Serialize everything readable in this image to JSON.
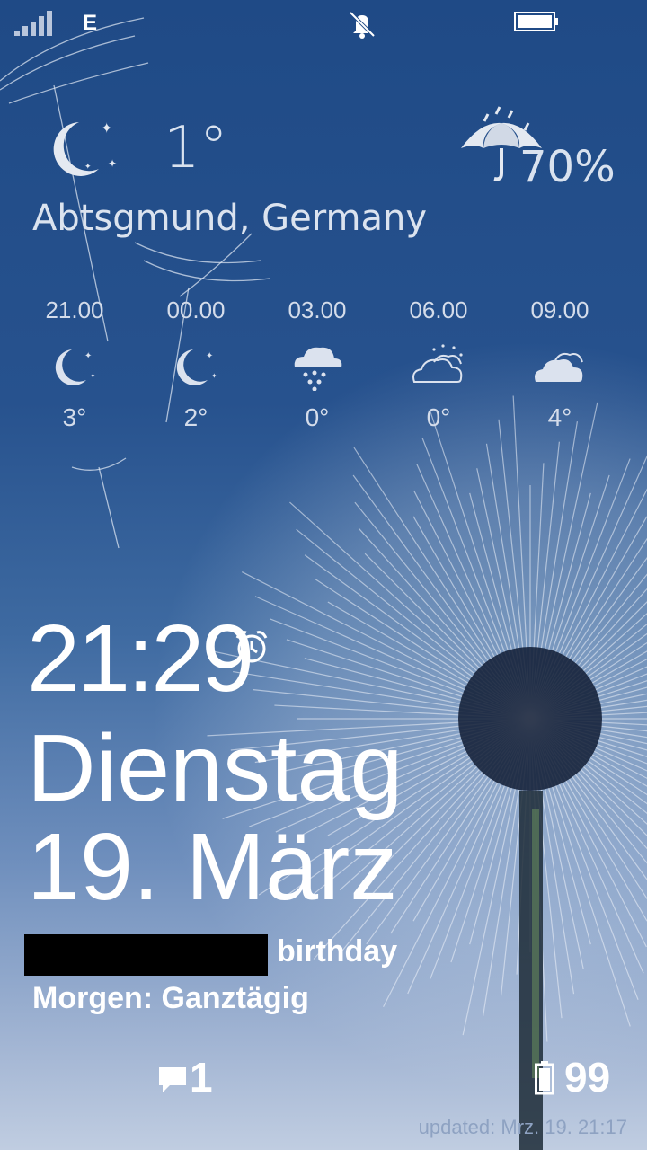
{
  "status_bar": {
    "network": "E",
    "signal_icon": "signal-bars-icon",
    "mute_icon": "bell-muted-icon",
    "battery_icon": "battery-icon"
  },
  "weather": {
    "current_temp": "1°",
    "current_icon": "moon-stars-icon",
    "precip_icon": "umbrella-rain-icon",
    "precip": "70%",
    "location": "Abtsgmund, Germany",
    "forecast": [
      {
        "time": "21.00",
        "icon": "moon-stars-icon",
        "temp": "3°"
      },
      {
        "time": "00.00",
        "icon": "moon-stars-icon",
        "temp": "2°"
      },
      {
        "time": "03.00",
        "icon": "snow-cloud-icon",
        "temp": "0°"
      },
      {
        "time": "06.00",
        "icon": "cloud-sun-icon",
        "temp": "0°"
      },
      {
        "time": "09.00",
        "icon": "cloud-icon",
        "temp": "4°"
      }
    ]
  },
  "lock": {
    "time": "21:29",
    "alarm_icon": "alarm-clock-icon",
    "weekday": "Dienstag",
    "date": "19. März",
    "event_suffix": "birthday",
    "tomorrow": "Morgen: Ganztägig"
  },
  "notifications": {
    "messages_icon": "message-icon",
    "messages_count": "1",
    "battery_icon": "battery-icon",
    "battery_level": "99"
  },
  "footer": {
    "updated": "updated: Mrz. 19. 21:17"
  },
  "colors": {
    "sky_top": "#1f4a86",
    "sky_bottom": "#c0cde1",
    "text": "#ffffff"
  }
}
